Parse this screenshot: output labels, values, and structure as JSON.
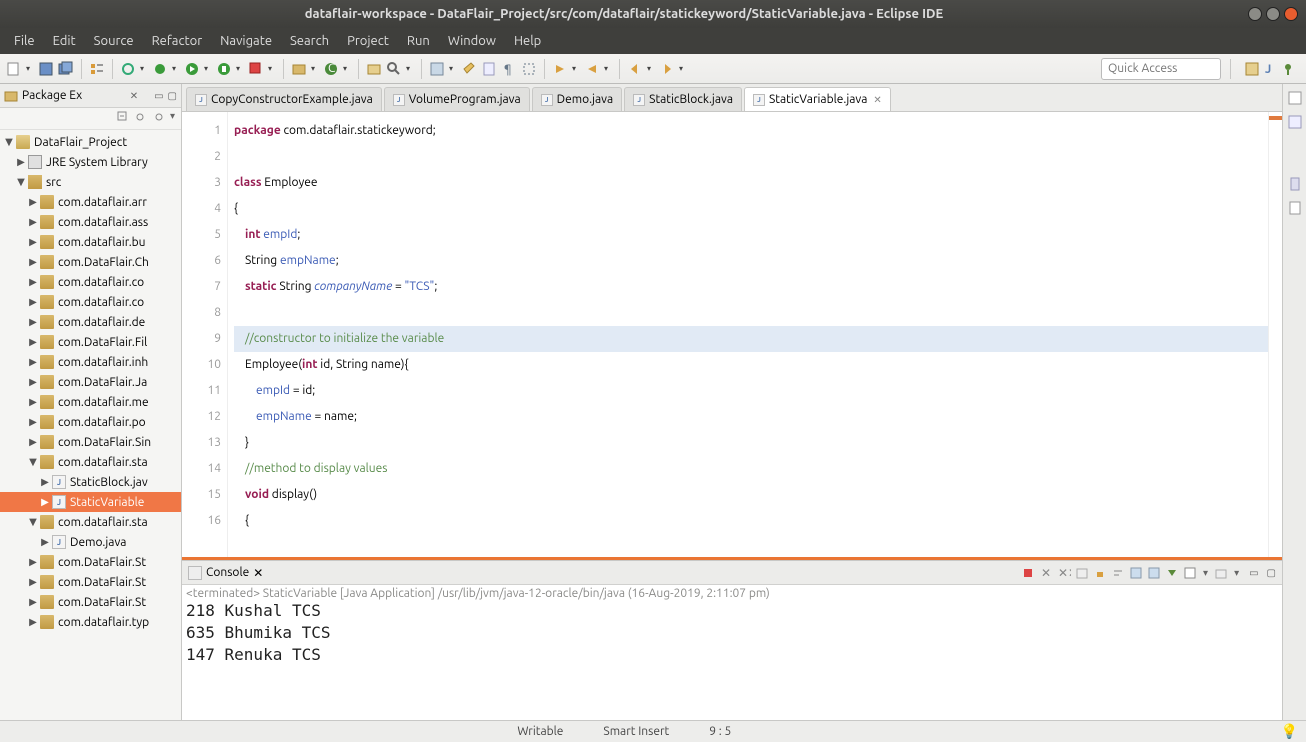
{
  "window": {
    "title": "dataflair-workspace - DataFlair_Project/src/com/dataflair/statickeyword/StaticVariable.java - Eclipse IDE"
  },
  "menu": [
    "File",
    "Edit",
    "Source",
    "Refactor",
    "Navigate",
    "Search",
    "Project",
    "Run",
    "Window",
    "Help"
  ],
  "quick_access": {
    "placeholder": "Quick Access"
  },
  "package_explorer": {
    "title": "Package Ex",
    "project": "DataFlair_Project",
    "jre": "JRE System Library",
    "src": "src",
    "packages": [
      "com.dataflair.arr",
      "com.dataflair.ass",
      "com.dataflair.bu",
      "com.DataFlair.Ch",
      "com.dataflair.co",
      "com.dataflair.co",
      "com.dataflair.de",
      "com.DataFlair.Fil",
      "com.dataflair.inh",
      "com.DataFlair.Ja",
      "com.dataflair.me",
      "com.dataflair.po",
      "com.DataFlair.Sin",
      "com.dataflair.sta",
      "com.dataflair.sta",
      "com.DataFlair.St",
      "com.DataFlair.St",
      "com.DataFlair.St",
      "com.dataflair.typ"
    ],
    "files_in_pkg14": [
      "StaticBlock.jav",
      "StaticVariable"
    ],
    "file_in_pkg15": "Demo.java"
  },
  "editor_tabs": [
    {
      "label": "CopyConstructorExample.java",
      "active": false
    },
    {
      "label": "VolumeProgram.java",
      "active": false
    },
    {
      "label": "Demo.java",
      "active": false
    },
    {
      "label": "StaticBlock.java",
      "active": false
    },
    {
      "label": "StaticVariable.java",
      "active": true
    }
  ],
  "code_lines": [
    {
      "n": "1",
      "segs": [
        [
          "kw",
          "package"
        ],
        [
          "",
          " com.dataflair.statickeyword;"
        ]
      ]
    },
    {
      "n": "2",
      "segs": []
    },
    {
      "n": "3",
      "segs": [
        [
          "kw",
          "class"
        ],
        [
          "",
          " Employee"
        ]
      ]
    },
    {
      "n": "4",
      "segs": [
        [
          "",
          "{"
        ]
      ]
    },
    {
      "n": "5",
      "segs": [
        [
          "",
          "    "
        ],
        [
          "kw",
          "int"
        ],
        [
          "",
          " "
        ],
        [
          "fld",
          "empId"
        ],
        [
          "",
          ";"
        ]
      ]
    },
    {
      "n": "6",
      "segs": [
        [
          "",
          "    String "
        ],
        [
          "fld",
          "empName"
        ],
        [
          "",
          ";"
        ]
      ]
    },
    {
      "n": "7",
      "segs": [
        [
          "",
          "    "
        ],
        [
          "kw",
          "static"
        ],
        [
          "",
          " String "
        ],
        [
          "sfld",
          "companyName"
        ],
        [
          "",
          " = "
        ],
        [
          "str",
          "\"TCS\""
        ],
        [
          "",
          ";"
        ]
      ]
    },
    {
      "n": "8",
      "segs": []
    },
    {
      "n": "9",
      "hl": true,
      "segs": [
        [
          "",
          "    "
        ],
        [
          "cmt",
          "//constructor to initialize the variable"
        ]
      ]
    },
    {
      "n": "10",
      "segs": [
        [
          "",
          "    Employee("
        ],
        [
          "kw",
          "int"
        ],
        [
          "",
          " id, String name){"
        ]
      ]
    },
    {
      "n": "11",
      "segs": [
        [
          "",
          "        "
        ],
        [
          "fld",
          "empId"
        ],
        [
          "",
          " = id;"
        ]
      ]
    },
    {
      "n": "12",
      "segs": [
        [
          "",
          "        "
        ],
        [
          "fld",
          "empName"
        ],
        [
          "",
          " = name;"
        ]
      ]
    },
    {
      "n": "13",
      "segs": [
        [
          "",
          "    }"
        ]
      ]
    },
    {
      "n": "14",
      "segs": [
        [
          "",
          "    "
        ],
        [
          "cmt",
          "//method to display values"
        ]
      ]
    },
    {
      "n": "15",
      "segs": [
        [
          "",
          "    "
        ],
        [
          "kw",
          "void"
        ],
        [
          "",
          " display()"
        ]
      ]
    },
    {
      "n": "16",
      "segs": [
        [
          "",
          "    {"
        ]
      ]
    }
  ],
  "console": {
    "title": "Console",
    "terminated": "<terminated> StaticVariable [Java Application] /usr/lib/jvm/java-12-oracle/bin/java (16-Aug-2019, 2:11:07 pm)",
    "output": "218 Kushal TCS\n635 Bhumika TCS\n147 Renuka TCS"
  },
  "status": {
    "writable": "Writable",
    "insert": "Smart Insert",
    "pos": "9 : 5"
  }
}
